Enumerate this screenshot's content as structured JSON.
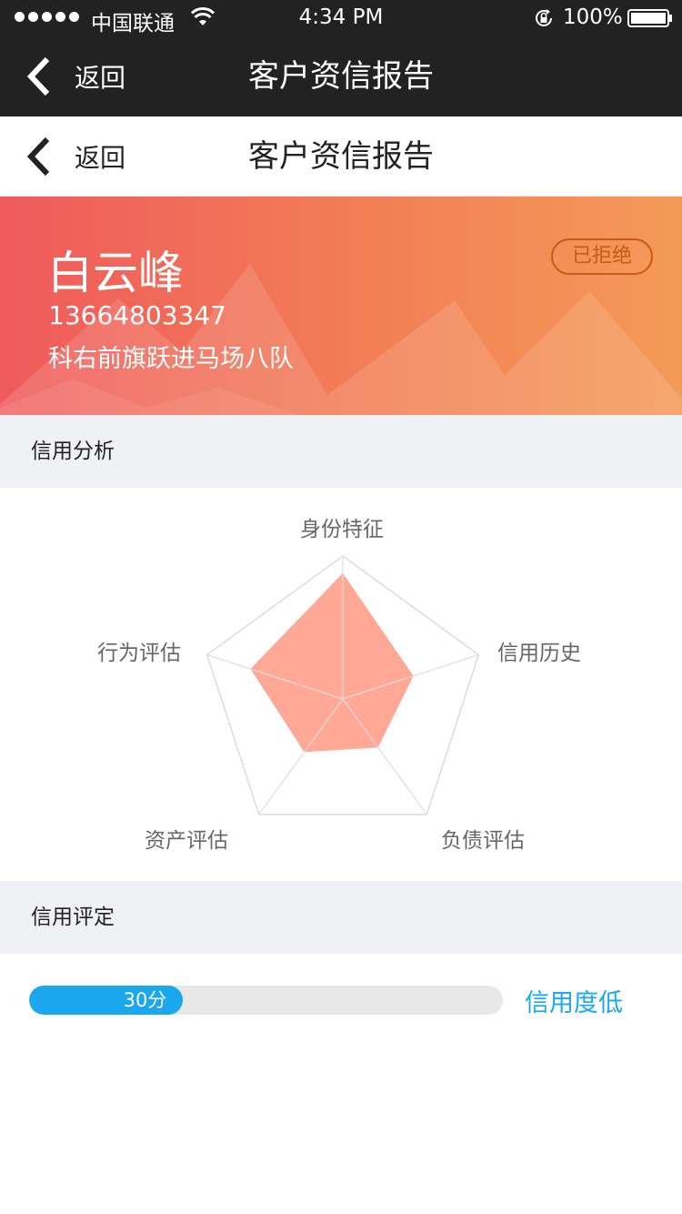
{
  "status_bar": {
    "carrier": "中国联通",
    "time": "4:34 PM",
    "battery": "100%"
  },
  "nav_primary": {
    "back_label": "返回",
    "title": "客户资信报告"
  },
  "nav_secondary": {
    "back_label": "返回",
    "title": "客户资信报告"
  },
  "customer": {
    "name": "白云峰",
    "phone": "13664803347",
    "address": "科右前旗跃进马场八队",
    "status": "已拒绝"
  },
  "credit_analysis": {
    "header": "信用分析",
    "dimensions": [
      "身份特征",
      "信用历史",
      "负债评估",
      "资产评估",
      "行为评估"
    ],
    "values": [
      0.88,
      0.52,
      0.42,
      0.46,
      0.68
    ],
    "max": 1,
    "fill_color": "#ffa896"
  },
  "credit_rating": {
    "header": "信用评定",
    "score": 30,
    "score_label": "30分",
    "score_fraction": 0.325,
    "level": "信用度低",
    "accent": "#1aa7ee"
  }
}
